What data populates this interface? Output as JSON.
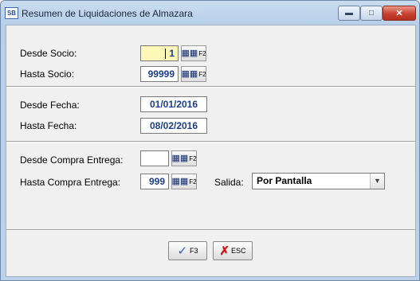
{
  "window": {
    "icon_text": "SB",
    "title": "Resumen de Liquidaciones de Almazara"
  },
  "socio": {
    "desde_label": "Desde Socio:",
    "desde_value": "1",
    "hasta_label": "Hasta Socio:",
    "hasta_value": "99999",
    "lookup_key": "F2"
  },
  "fecha": {
    "desde_label": "Desde Fecha:",
    "desde_value": "01/01/2016",
    "hasta_label": "Hasta Fecha:",
    "hasta_value": "08/02/2016"
  },
  "compra": {
    "desde_label": "Desde Compra Entrega:",
    "desde_value": "",
    "hasta_label": "Hasta Compra Entrega:",
    "hasta_value": "999",
    "lookup_key": "F2"
  },
  "salida": {
    "label": "Salida:",
    "value": "Por Pantalla"
  },
  "buttons": {
    "ok_label": "F3",
    "esc_label": "ESC"
  },
  "colors": {
    "active_field": "#fdf7b8",
    "value_text": "#1a3d8c",
    "title_bar": "#c9dcf0"
  }
}
